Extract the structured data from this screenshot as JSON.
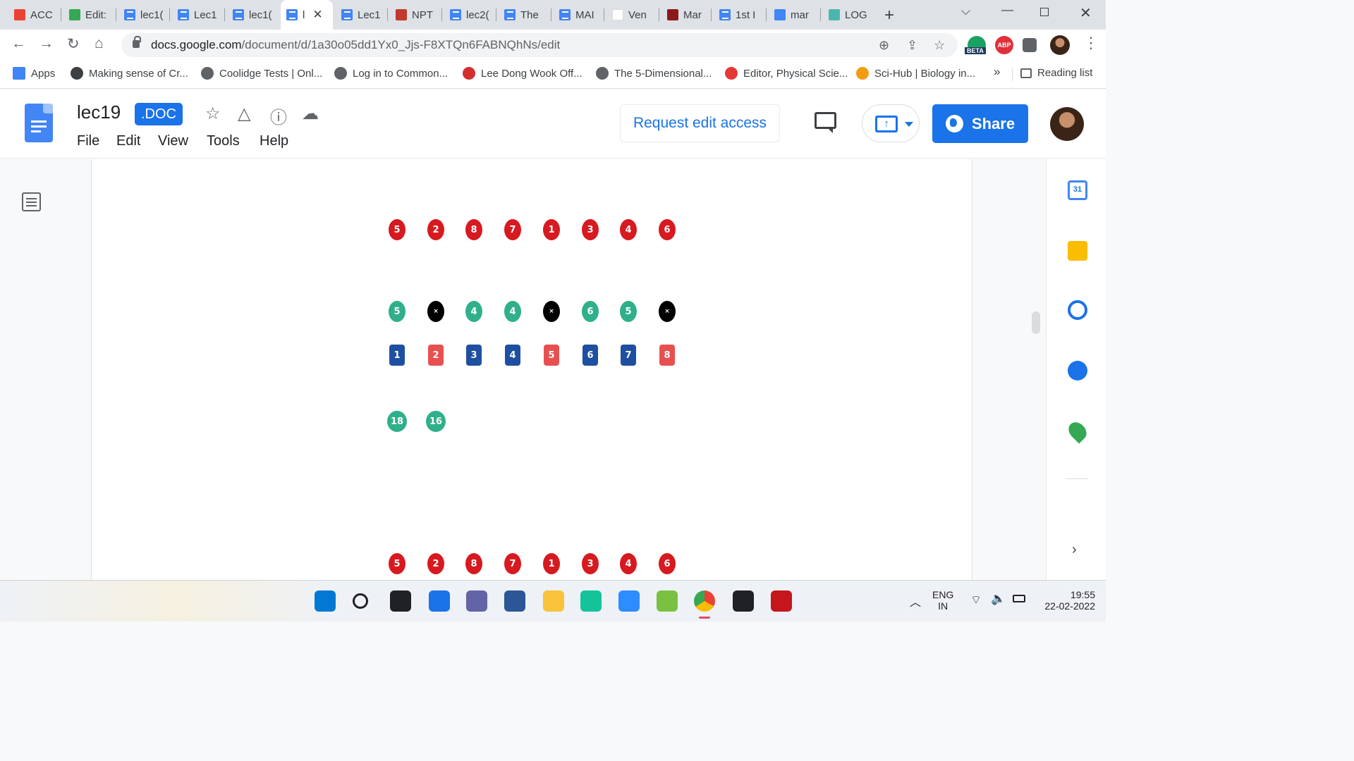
{
  "browser": {
    "tabs": [
      {
        "label": "ACC",
        "icon": "gmail-icon"
      },
      {
        "label": "Edit:",
        "icon": "drive-icon"
      },
      {
        "label": "lec1(",
        "icon": "docs-icon"
      },
      {
        "label": "Lec1",
        "icon": "docs-icon"
      },
      {
        "label": "lec1(",
        "icon": "docs-icon"
      },
      {
        "label": "l",
        "icon": "docs-icon",
        "active": true
      },
      {
        "label": "Lec1",
        "icon": "docs-icon"
      },
      {
        "label": "NPT",
        "icon": "nptel-icon"
      },
      {
        "label": "lec2(",
        "icon": "docs-icon"
      },
      {
        "label": "The",
        "icon": "docs-icon"
      },
      {
        "label": "MAI",
        "icon": "docs-icon"
      },
      {
        "label": "Ven",
        "icon": "blank-icon"
      },
      {
        "label": "Mar",
        "icon": "ja-icon"
      },
      {
        "label": "1st I",
        "icon": "docs-icon"
      },
      {
        "label": "mar",
        "icon": "google-icon"
      },
      {
        "label": "LOG",
        "icon": "pinwheel-icon"
      }
    ],
    "url_domain": "docs.google.com",
    "url_path": "/document/d/1a30o05dd1Yx0_Jjs-F8XTQn6FABNQhNs/edit",
    "beta_label": "BETA",
    "abp_label": "ABP",
    "bookmarks": [
      {
        "label": "Apps",
        "icon": "apps-grid-icon"
      },
      {
        "label": "Making sense of Cr...",
        "icon": "link-icon"
      },
      {
        "label": "Coolidge Tests | Onl...",
        "icon": "globe-icon"
      },
      {
        "label": "Log in to Common...",
        "icon": "globe-icon"
      },
      {
        "label": "Lee Dong Wook Off...",
        "icon": "dw-icon"
      },
      {
        "label": "The 5-Dimensional...",
        "icon": "tool-icon"
      },
      {
        "label": "Editor, Physical Scie...",
        "icon": "c-icon"
      },
      {
        "label": "Sci-Hub | Biology in...",
        "icon": "scihub-icon"
      }
    ],
    "bookmarks_overflow": "»",
    "reading_list": "Reading list"
  },
  "docs": {
    "title": "lec19",
    "badge": ".DOC",
    "menu": [
      "File",
      "Edit",
      "View",
      "Tools",
      "Help"
    ],
    "request_edit": "Request edit access",
    "share": "Share",
    "colors": {
      "accent": "#1a73e8",
      "red": "#d71920",
      "green": "#2fb08a",
      "black": "#000000",
      "blue": "#1f4fa0",
      "light_red": "#e85050"
    }
  },
  "content": {
    "row1": [
      "5",
      "2",
      "8",
      "7",
      "1",
      "3",
      "4",
      "6"
    ],
    "row2": [
      {
        "text": "5",
        "style": "green"
      },
      {
        "text": "×",
        "style": "black"
      },
      {
        "text": "4",
        "style": "green"
      },
      {
        "text": "4",
        "style": "green"
      },
      {
        "text": "×",
        "style": "black"
      },
      {
        "text": "6",
        "style": "green"
      },
      {
        "text": "5",
        "style": "green"
      },
      {
        "text": "×",
        "style": "black"
      }
    ],
    "row3": [
      {
        "text": "1",
        "style": "blue"
      },
      {
        "text": "2",
        "style": "red"
      },
      {
        "text": "3",
        "style": "blue"
      },
      {
        "text": "4",
        "style": "blue"
      },
      {
        "text": "5",
        "style": "red"
      },
      {
        "text": "6",
        "style": "blue"
      },
      {
        "text": "7",
        "style": "blue"
      },
      {
        "text": "8",
        "style": "red"
      }
    ],
    "row4": [
      "18",
      "16"
    ],
    "row5": [
      "5",
      "2",
      "8",
      "7",
      "1",
      "3",
      "4",
      "6"
    ]
  },
  "sidepanel": {
    "calendar_day": "31",
    "items": [
      "calendar-icon",
      "keep-icon",
      "tasks-icon",
      "contacts-icon",
      "maps-icon"
    ]
  },
  "taskbar": {
    "apps": [
      "start-icon",
      "search-icon",
      "task-view-icon",
      "widgets-icon",
      "teams-chat-icon",
      "store-icon",
      "file-explorer-icon",
      "grammarly-icon",
      "zoom-icon",
      "evernote-icon",
      "chrome-icon",
      "sticky-notes-icon",
      "acrobat-icon"
    ],
    "lang_top": "ENG",
    "lang_bottom": "IN",
    "time": "19:55",
    "date": "22-02-2022"
  }
}
